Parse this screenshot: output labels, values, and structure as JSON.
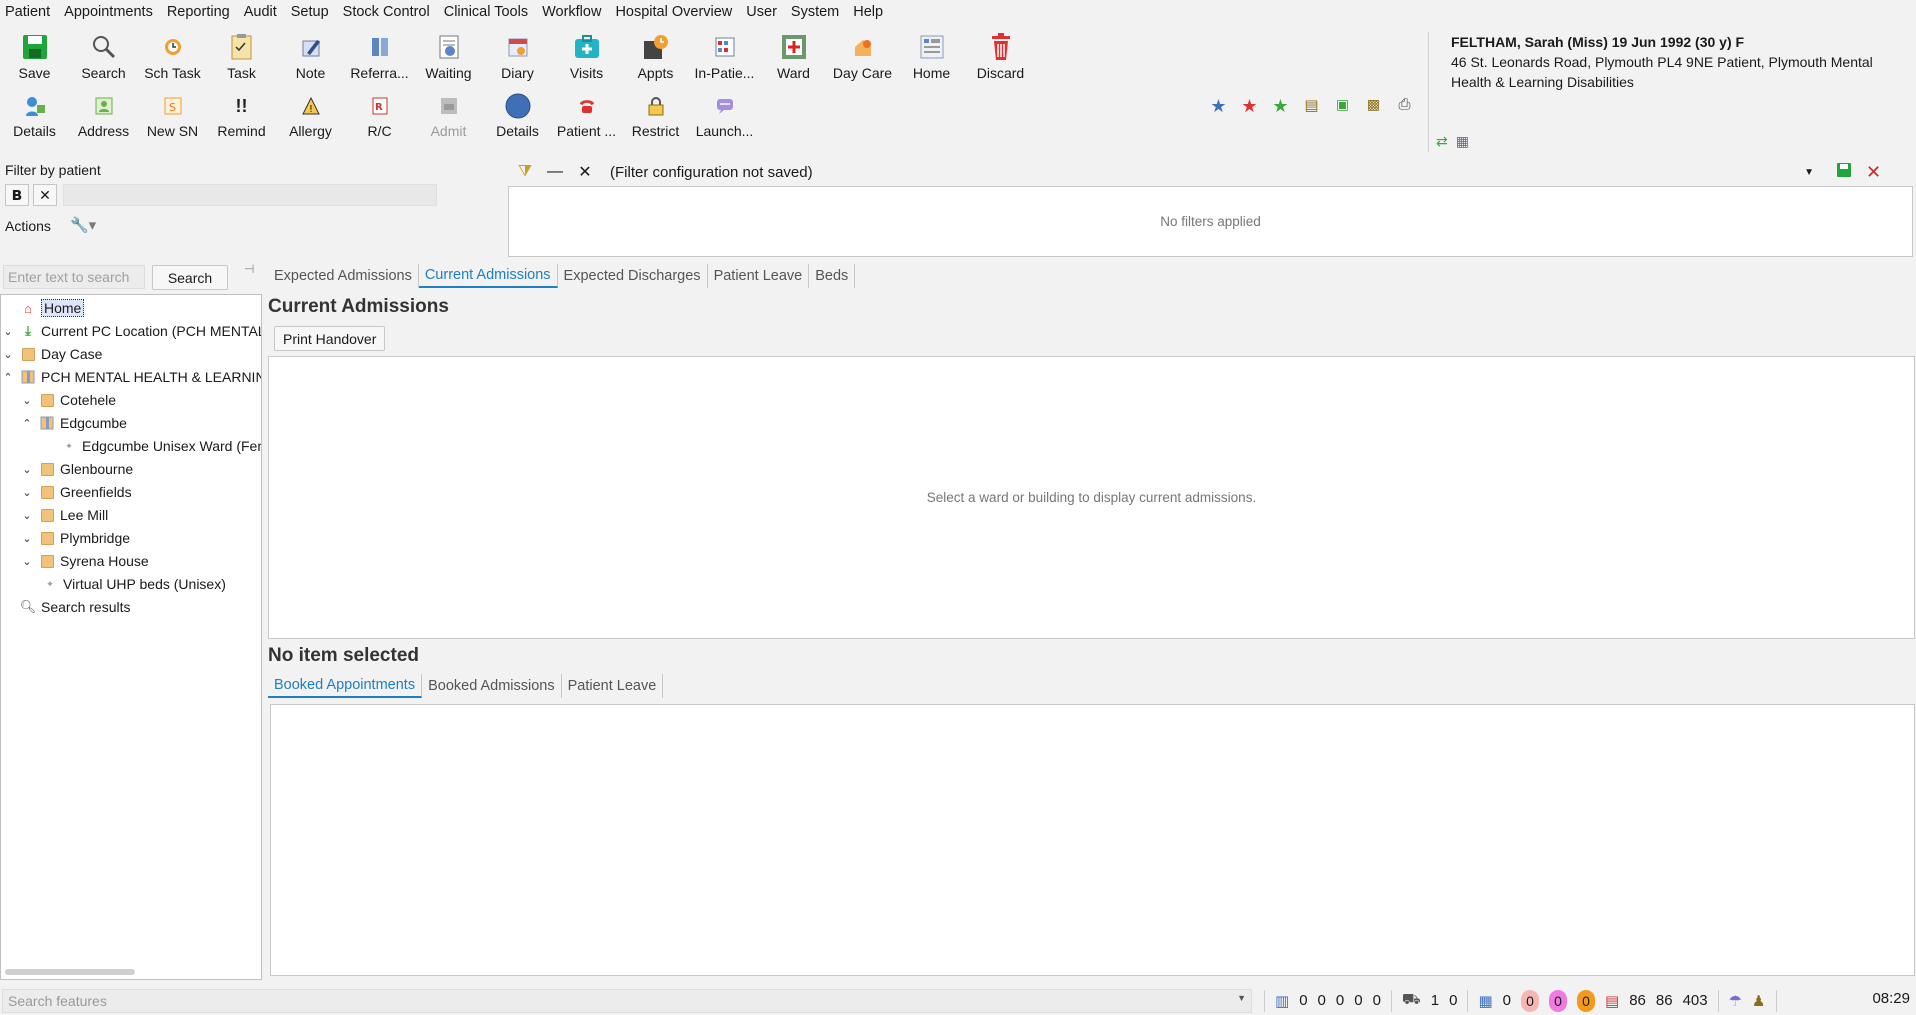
{
  "menu": [
    "Patient",
    "Appointments",
    "Reporting",
    "Audit",
    "Setup",
    "Stock Control",
    "Clinical Tools",
    "Workflow",
    "Hospital Overview",
    "User",
    "System",
    "Help"
  ],
  "toolbar_top": [
    {
      "label": "Save",
      "icon": "save-icon"
    },
    {
      "label": "Search",
      "icon": "search-icon"
    },
    {
      "label": "Sch Task",
      "icon": "scheduled-task-icon"
    },
    {
      "label": "Task",
      "icon": "task-icon"
    },
    {
      "label": "Note",
      "icon": "note-icon"
    },
    {
      "label": "Referra...",
      "icon": "referral-icon"
    },
    {
      "label": "Waiting",
      "icon": "waiting-list-icon"
    },
    {
      "label": "Diary",
      "icon": "diary-icon"
    },
    {
      "label": "Visits",
      "icon": "visits-icon"
    },
    {
      "label": "Appts",
      "icon": "appointments-icon"
    },
    {
      "label": "In-Patie...",
      "icon": "inpatient-icon"
    },
    {
      "label": "Ward",
      "icon": "ward-icon"
    },
    {
      "label": "Day Care",
      "icon": "day-care-icon"
    },
    {
      "label": "Home",
      "icon": "home-icon"
    },
    {
      "label": "Discard",
      "icon": "discard-icon"
    }
  ],
  "toolbar_bottom": [
    {
      "label": "Details",
      "icon": "patient-details-icon"
    },
    {
      "label": "Address",
      "icon": "address-icon"
    },
    {
      "label": "New SN",
      "icon": "new-sn-icon"
    },
    {
      "label": "Remind",
      "icon": "remind-icon"
    },
    {
      "label": "Allergy",
      "icon": "allergy-icon"
    },
    {
      "label": "R/C",
      "icon": "rc-icon"
    },
    {
      "label": "Admit",
      "icon": "admit-icon",
      "disabled": true
    },
    {
      "label": "Details",
      "icon": "details-circle-icon"
    },
    {
      "label": "Patient ...",
      "icon": "patient-contact-icon"
    },
    {
      "label": "Restrict",
      "icon": "restrict-icon"
    },
    {
      "label": "Launch...",
      "icon": "launch-icon"
    }
  ],
  "patient": {
    "name": "FELTHAM, Sarah (Miss) 19 Jun 1992 (30 y) F",
    "address": "46 St. Leonards Road, Plymouth PL4 9NE  Patient, Plymouth Mental Health & Learning Disabilities"
  },
  "filter": {
    "by_patient_label": "Filter by patient",
    "actions_label": "Actions",
    "config_text": "(Filter configuration not saved)",
    "no_filters": "No filters applied"
  },
  "search": {
    "placeholder": "Enter text to search",
    "button": "Search"
  },
  "tree": {
    "home": "Home",
    "current_pc": "Current PC Location (PCH MENTAL HEALTH",
    "day_case": "Day Case",
    "pch": "PCH MENTAL HEALTH & LEARNING DISABILITIES",
    "cotehele": "Cotehele",
    "edgcumbe": "Edgcumbe",
    "edgcumbe_ward": "Edgcumbe Unisex Ward (Female)",
    "glenbourne": "Glenbourne",
    "greenfields": "Greenfields",
    "lee_mill": "Lee Mill",
    "plymbridge": "Plymbridge",
    "syrena": "Syrena House",
    "virtual": "Virtual UHP beds (Unisex)",
    "search_results": "Search results"
  },
  "top_tabs": [
    "Expected Admissions",
    "Current Admissions",
    "Expected Discharges",
    "Patient Leave",
    "Beds"
  ],
  "active_top_tab": "Current Admissions",
  "current_admissions": {
    "title": "Current Admissions",
    "print_button": "Print Handover",
    "empty_message": "Select a ward or building to display current admissions."
  },
  "detail": {
    "title": "No item selected"
  },
  "bottom_tabs": [
    "Booked Appointments",
    "Booked Admissions",
    "Patient Leave"
  ],
  "status": {
    "feature_placeholder": "Search features",
    "counts_a": [
      "0",
      "0",
      "0",
      "0",
      "0"
    ],
    "count_b": [
      "1",
      "0"
    ],
    "count_c": "0",
    "badges": [
      "0",
      "0",
      "0"
    ],
    "badge_colors": [
      "#f5b6b6",
      "#f07be0",
      "#f39a1b"
    ],
    "totals": [
      "86",
      "86",
      "403"
    ],
    "time": "08:29"
  },
  "colors": {
    "accent": "#1e7fc6",
    "save_green": "#1fa53a",
    "discard_red": "#e03131"
  }
}
